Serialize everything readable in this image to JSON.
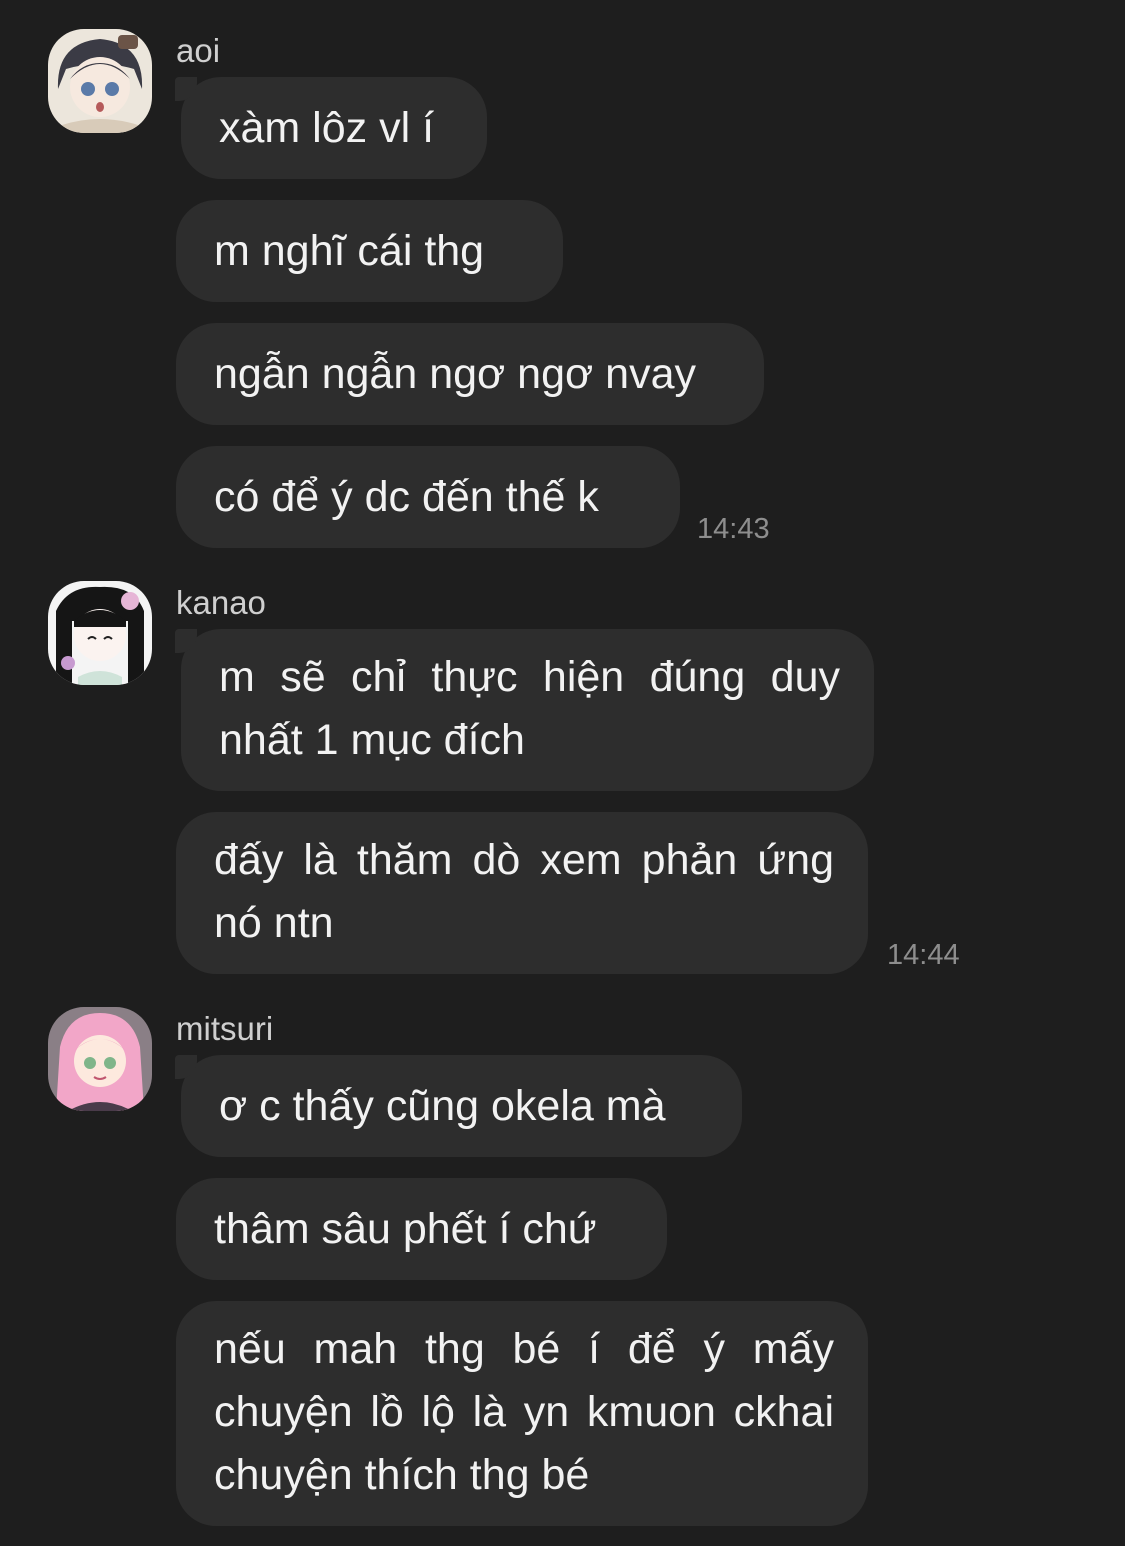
{
  "groups": [
    {
      "sender": "aoi",
      "avatar_icon": "aoi-avatar-icon",
      "messages": [
        "xàm lôz vl í",
        "m nghĩ cái thg",
        "ngẫn ngẫn ngơ ngơ nvay",
        "có để ý dc đến thế k"
      ],
      "time": "14:43"
    },
    {
      "sender": "kanao",
      "avatar_icon": "kanao-avatar-icon",
      "messages": [
        "m sẽ chỉ thực hiện đúng duy nhất 1 mục đích",
        "đấy là thăm dò xem phản ứng nó ntn"
      ],
      "time": "14:44"
    },
    {
      "sender": "mitsuri",
      "avatar_icon": "mitsuri-avatar-icon",
      "messages": [
        "ơ c thấy cũng okela mà",
        "thâm sâu phết í chứ",
        "nếu mah thg bé í để ý mấy chuyện lồ lộ là yn kmuon ckhai chuyện thích thg bé"
      ]
    }
  ],
  "colors": {
    "background": "#1e1e1e",
    "bubble": "#2d2d2d",
    "text": "#f2f2f2",
    "sender": "#cfcfcf",
    "time": "#8e8e8e"
  }
}
